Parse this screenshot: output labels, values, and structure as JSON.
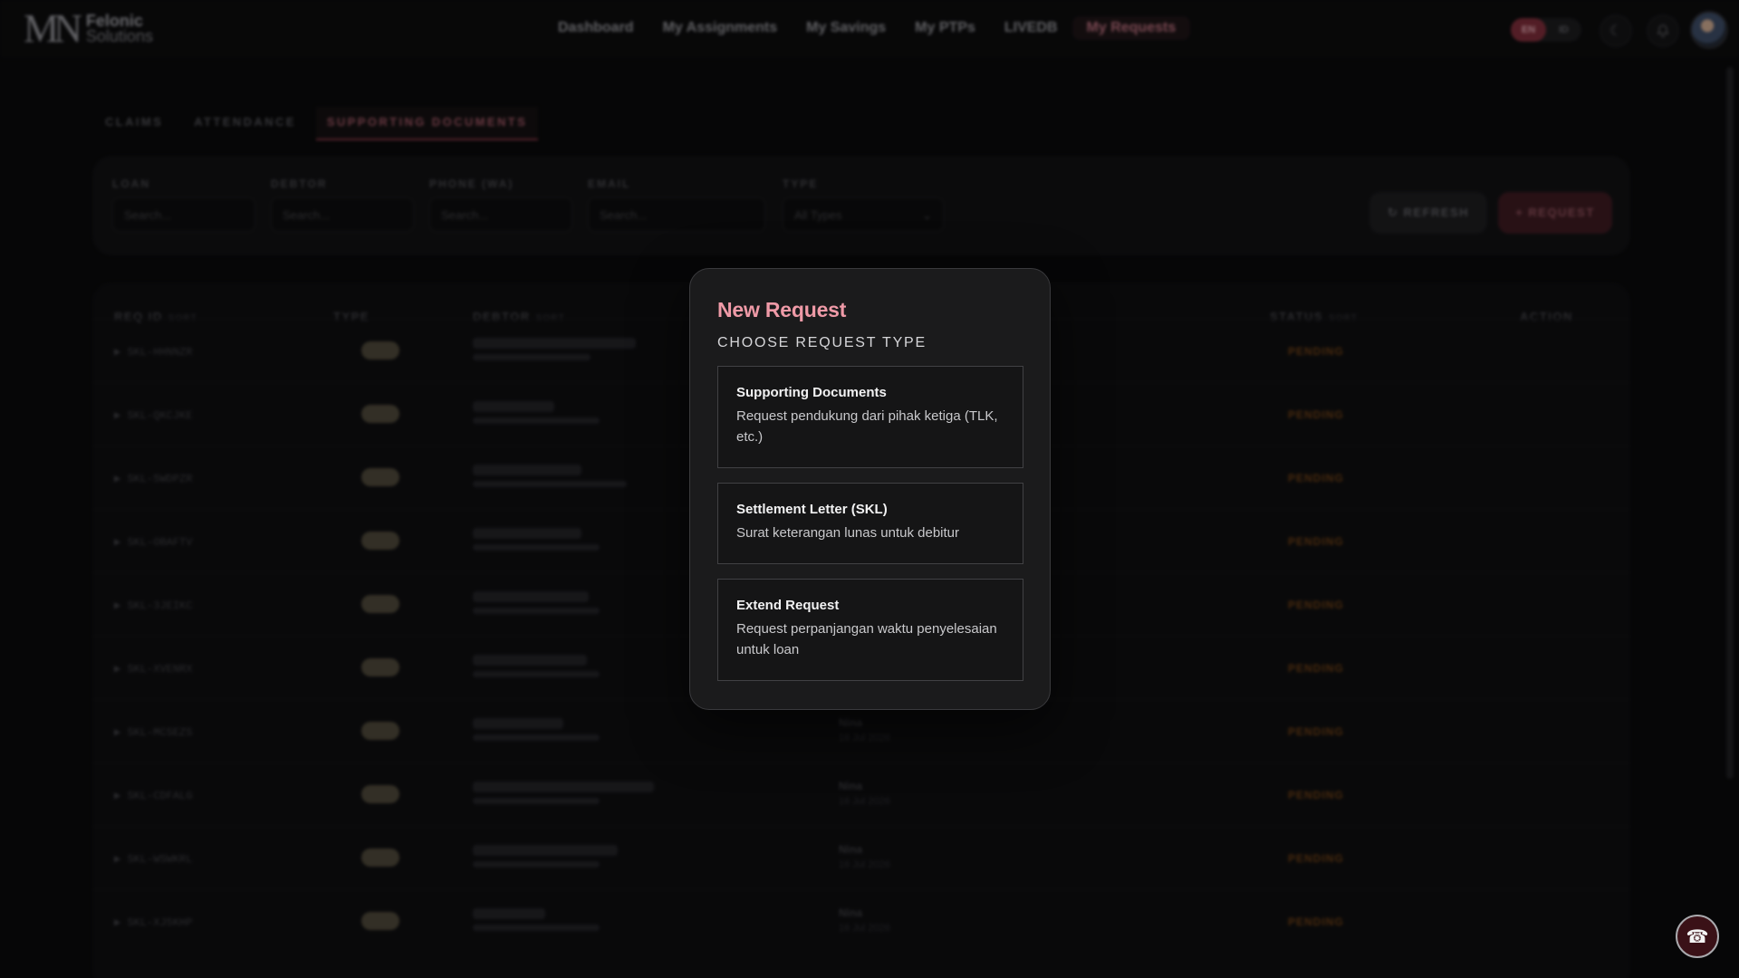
{
  "brand": {
    "line1": "Felonic",
    "line2": "Solutions",
    "mark": "MN"
  },
  "nav": [
    "Dashboard",
    "My Assignments",
    "My Savings",
    "My PTPs",
    "LIVEDB",
    "My Requests"
  ],
  "lang": {
    "active": "EN",
    "other": "ID"
  },
  "tabs": [
    "CLAIMS",
    "ATTENDANCE",
    "SUPPORTING DOCUMENTS"
  ],
  "filters": [
    {
      "label": "LOAN",
      "placeholder": "Search..."
    },
    {
      "label": "DEBTOR",
      "placeholder": "Search..."
    },
    {
      "label": "PHONE (WA)",
      "placeholder": "Search..."
    },
    {
      "label": "EMAIL",
      "placeholder": "Search..."
    },
    {
      "label": "TYPE",
      "value": "All Types"
    }
  ],
  "buttons": {
    "refresh": "REFRESH",
    "request": "+ REQUEST"
  },
  "table": {
    "headers": {
      "req_id": "REQ ID",
      "type": "TYPE",
      "debtor": "DEBTOR",
      "status": "STATUS",
      "action": "ACTION",
      "sort": "SORT"
    },
    "rows": [
      {
        "id": "SKL-HHNNZR",
        "status": "PENDING"
      },
      {
        "id": "SKL-QKCJKE",
        "status": "PENDING"
      },
      {
        "id": "SKL-5WDPZR",
        "status": "PENDING"
      },
      {
        "id": "SKL-OBAFTV",
        "status": "PENDING"
      },
      {
        "id": "SKL-3JEIKC",
        "status": "PENDING"
      },
      {
        "id": "SKL-XVENRX",
        "status": "PENDING"
      },
      {
        "id": "SKL-MCSEZS",
        "status": "PENDING",
        "assignee": "Nina",
        "date": "16 Jul 2026"
      },
      {
        "id": "SKL-CDFALG",
        "status": "PENDING",
        "assignee": "Nina",
        "date": "16 Jul 2026"
      },
      {
        "id": "SKL-WSWKRL",
        "status": "PENDING",
        "assignee": "Nina",
        "date": "16 Jul 2026"
      },
      {
        "id": "SKL-XJ5KHP",
        "status": "PENDING",
        "assignee": "Nina",
        "date": "16 Jul 2026"
      }
    ]
  },
  "modal": {
    "title": "New Request",
    "subtitle": "CHOOSE REQUEST TYPE",
    "options": [
      {
        "title": "Supporting Documents",
        "desc": "Request pendukung dari pihak ketiga (TLK, etc.)"
      },
      {
        "title": "Settlement Letter (SKL)",
        "desc": "Surat keterangan lunas untuk debitur"
      },
      {
        "title": "Extend Request",
        "desc": "Request perpanjangan waktu penyelesaian untuk loan"
      }
    ]
  },
  "icons": {
    "moon": "moon-icon",
    "bell": "bell-icon",
    "refresh": "refresh-icon",
    "phone": "phone-icon",
    "chevron": "chevron-down-icon",
    "expand": "expand-arrow-icon"
  },
  "colors": {
    "accent": "#ef9aa7",
    "status_pending": "#c97a2a",
    "brand_dark": "#7a2c38"
  }
}
